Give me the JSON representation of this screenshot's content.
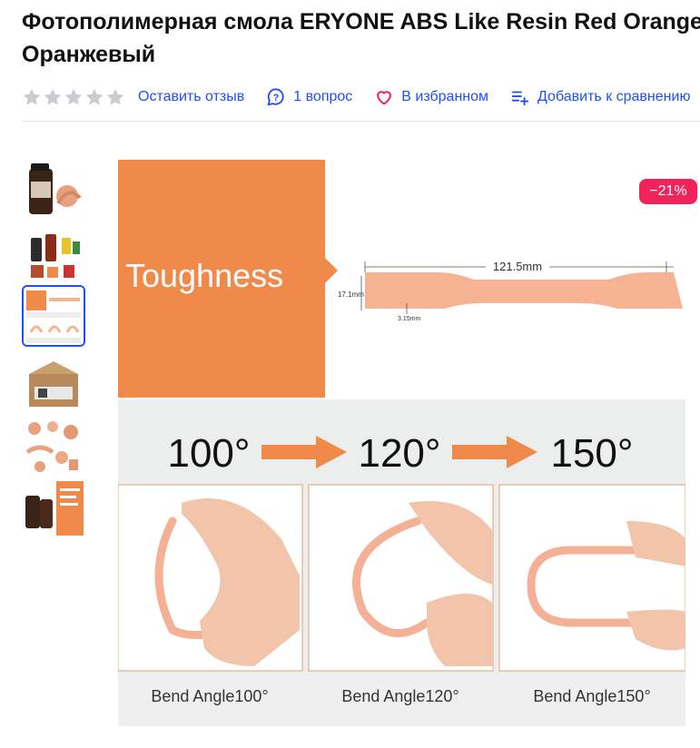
{
  "product": {
    "title_line1": "Фотополимерная смола ERYONE ABS Like Resin Red Orange",
    "title_line2": "Оранжевый"
  },
  "actions": {
    "rating_stars": 5,
    "rating_value": 0,
    "review_label": "Оставить отзыв",
    "question_label": "1 вопрос",
    "favorite_label": "В избранном",
    "compare_label": "Добавить к сравнению"
  },
  "gallery": {
    "thumbnail_count": 6,
    "active_index": 2,
    "discount_badge": "−21%"
  },
  "main_image": {
    "heading": "Toughness",
    "length_label": "121.5mm",
    "width_label": "17.1mm",
    "thickness_label": "3.15mm",
    "angles": [
      "100°",
      "120°",
      "150°"
    ],
    "bend_labels": [
      "Bend Angle100°",
      "Bend Angle120°",
      "Bend Angle150°"
    ]
  },
  "colors": {
    "accent": "#1f4ff0",
    "badge": "#f0245a",
    "orange": "#ef8a4b",
    "resin": "#f6b394",
    "star": "#c9ccd1"
  }
}
